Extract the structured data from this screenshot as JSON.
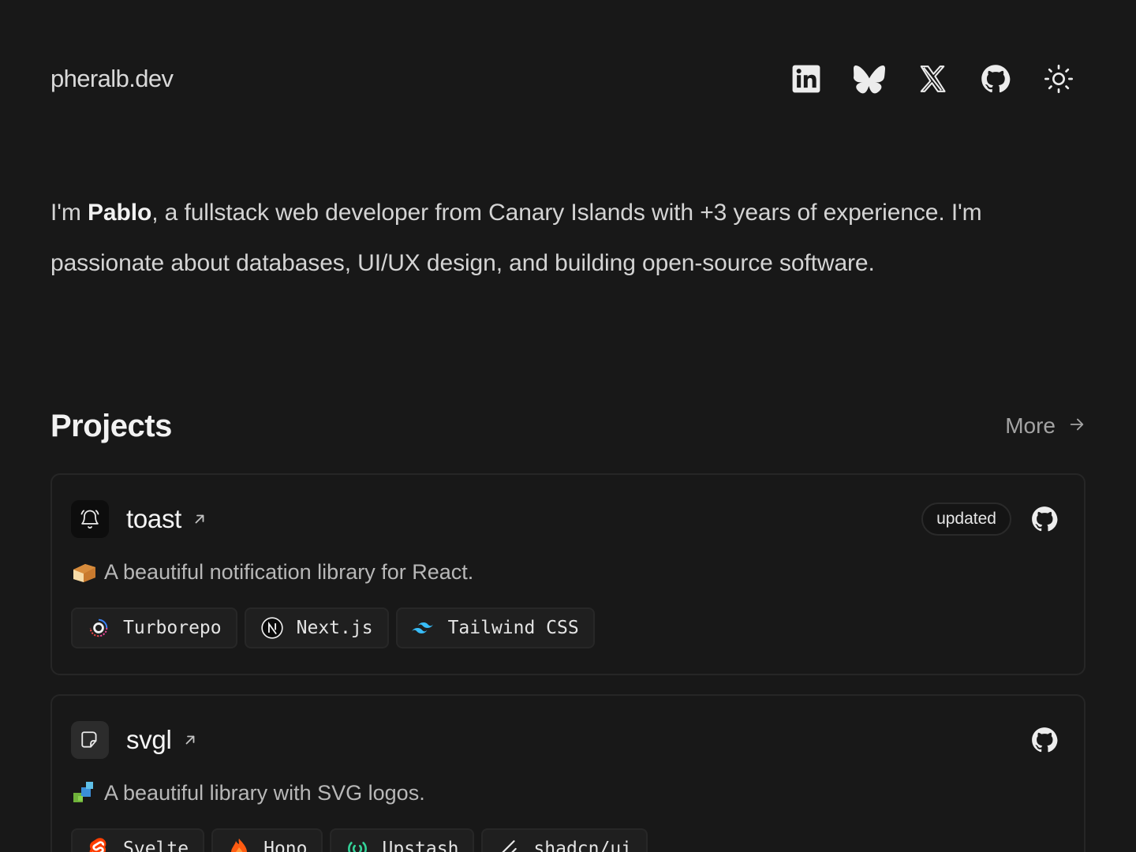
{
  "header": {
    "site_title": "pheralb.dev",
    "icons": [
      "linkedin-icon",
      "bluesky-icon",
      "x-icon",
      "github-icon",
      "sun-icon"
    ]
  },
  "intro": {
    "prefix": "I'm ",
    "name": "Pablo",
    "text": ", a fullstack web developer from Canary Islands with +3 years of experience. I'm passionate about databases, UI/UX design, and building open-source software."
  },
  "projects": {
    "title": "Projects",
    "more_label": "More",
    "items": [
      {
        "name": "toast",
        "icon": "bell-icon",
        "badge": "updated",
        "description_emoji": "bread-emoji",
        "description": "A beautiful notification library for React.",
        "tags": [
          {
            "label": "Turborepo",
            "icon": "turborepo-icon"
          },
          {
            "label": "Next.js",
            "icon": "nextjs-icon"
          },
          {
            "label": "Tailwind CSS",
            "icon": "tailwind-icon"
          }
        ]
      },
      {
        "name": "svgl",
        "icon": "sticker-icon",
        "description_emoji": "puzzle-emoji",
        "description": "A beautiful library with SVG logos.",
        "tags": [
          {
            "label": "Svelte",
            "icon": "svelte-icon"
          },
          {
            "label": "Hono",
            "icon": "hono-icon"
          },
          {
            "label": "Upstash",
            "icon": "upstash-icon"
          },
          {
            "label": "shadcn/ui",
            "icon": "shadcn-icon"
          }
        ]
      }
    ]
  },
  "colors": {
    "background": "#181818",
    "card_border": "#262626",
    "tag_background": "#1f1f1f",
    "text_primary": "#f2f2f2",
    "text_muted": "#a3a3a3"
  }
}
